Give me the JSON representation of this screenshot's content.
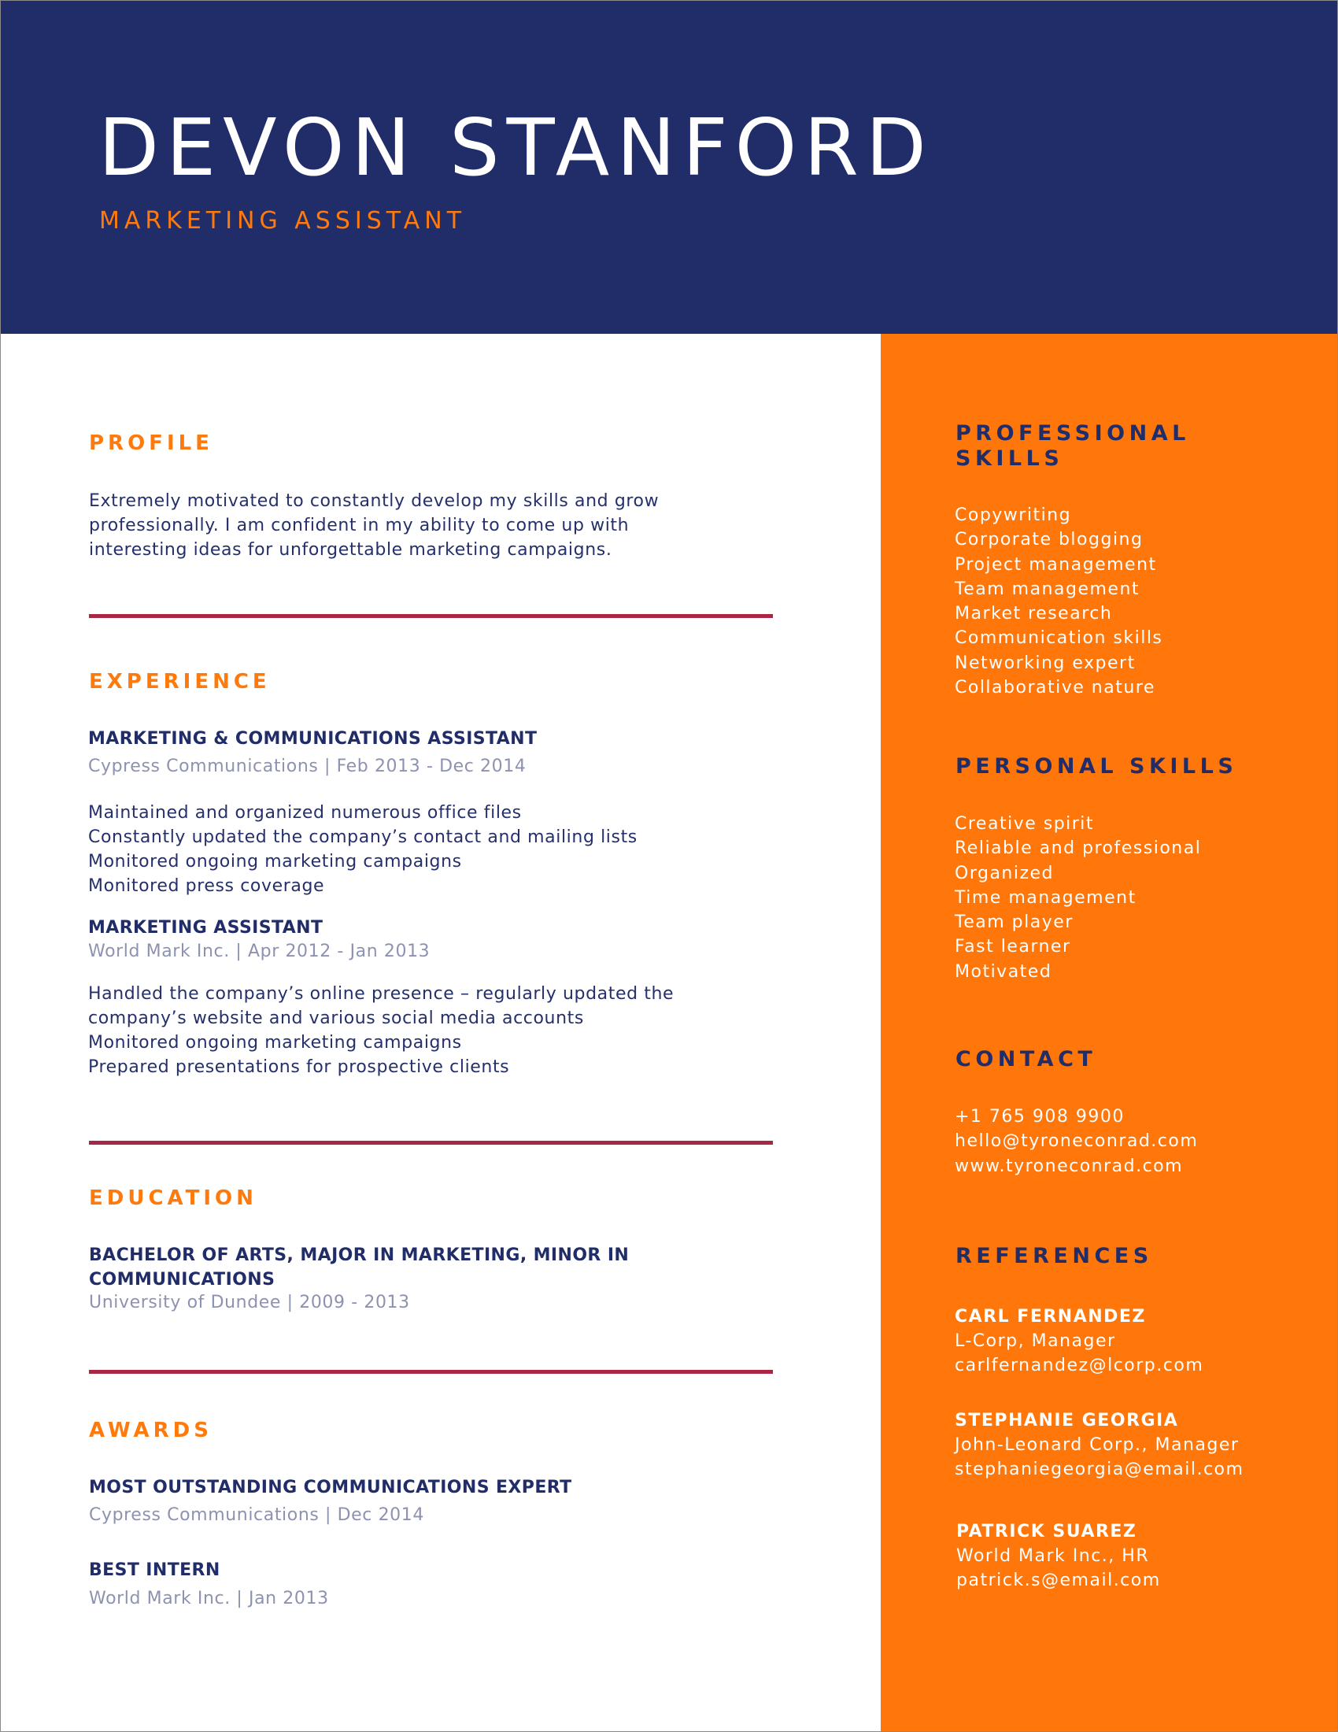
{
  "header": {
    "name": "DEVON STANFORD",
    "role": "MARKETING ASSISTANT"
  },
  "colors": {
    "navy": "#212d69",
    "orange": "#ff760a",
    "divider": "#a82745",
    "meta_gray": "#8d92b0"
  },
  "profile": {
    "title": "PROFILE",
    "lines": [
      "Extremely motivated to constantly develop my skills and grow",
      "professionally. I am confident in my ability to come up with",
      "interesting ideas for unforgettable marketing campaigns."
    ]
  },
  "experience": {
    "title": "EXPERIENCE",
    "jobs": [
      {
        "title": "MARKETING & COMMUNICATIONS ASSISTANT",
        "meta": "Cypress Communications | Feb 2013 - Dec 2014",
        "bullets": [
          "Maintained and organized numerous office files",
          "Constantly updated the company’s contact and mailing lists",
          "Monitored ongoing marketing campaigns",
          "Monitored press coverage"
        ]
      },
      {
        "title": "MARKETING ASSISTANT",
        "meta": "World Mark Inc. | Apr 2012 - Jan 2013",
        "bullets": [
          "Handled the company’s online presence – regularly updated the",
          "company’s website and various social media accounts",
          "Monitored ongoing marketing campaigns",
          "Prepared presentations for prospective clients"
        ]
      }
    ]
  },
  "education": {
    "title": "EDUCATION",
    "degree_lines": [
      "BACHELOR OF ARTS, MAJOR IN MARKETING, MINOR IN",
      "COMMUNICATIONS"
    ],
    "meta": "University of Dundee | 2009 - 2013"
  },
  "awards": {
    "title": "AWARDS",
    "items": [
      {
        "title": "MOST OUTSTANDING COMMUNICATIONS EXPERT",
        "meta": "Cypress Communications | Dec 2014"
      },
      {
        "title": "BEST INTERN",
        "meta": "World Mark Inc. | Jan 2013"
      }
    ]
  },
  "sidebar": {
    "professional_skills": {
      "title_lines": [
        "PROFESSIONAL",
        "SKILLS"
      ],
      "items": [
        "Copywriting",
        "Corporate blogging",
        "Project management",
        "Team management",
        "Market research",
        "Communication skills",
        "Networking expert",
        "Collaborative nature"
      ]
    },
    "personal_skills": {
      "title": "PERSONAL SKILLS",
      "items": [
        "Creative spirit",
        "Reliable and professional",
        "Organized",
        "Time management",
        "Team player",
        "Fast learner",
        "Motivated"
      ]
    },
    "contact": {
      "title": "CONTACT",
      "phone": "+1 765 908 9900",
      "email": "hello@tyroneconrad.com",
      "website": "www.tyroneconrad.com"
    },
    "references": {
      "title": "REFERENCES",
      "items": [
        {
          "name": "CARL FERNANDEZ",
          "position": "L-Corp, Manager",
          "email": "carlfernandez@lcorp.com"
        },
        {
          "name": "STEPHANIE GEORGIA",
          "position": "John-Leonard Corp., Manager",
          "email": "stephaniegeorgia@email.com"
        },
        {
          "name": "PATRICK SUAREZ",
          "position": "World Mark Inc., HR",
          "email": "patrick.s@email.com"
        }
      ]
    }
  }
}
